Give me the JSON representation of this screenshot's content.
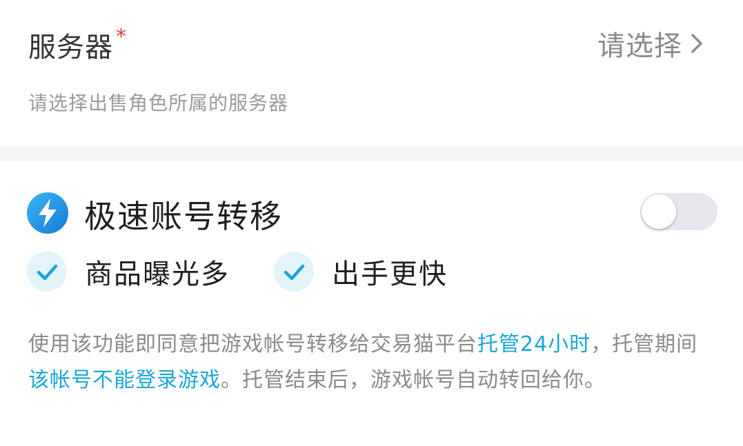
{
  "server": {
    "label": "服务器",
    "required_mark": "*",
    "select_placeholder": "请选择",
    "hint": "请选择出售角色所属的服务器"
  },
  "fast_transfer": {
    "title": "极速账号转移",
    "toggle_on": false,
    "features": [
      {
        "label": "商品曝光多"
      },
      {
        "label": "出手更快"
      }
    ],
    "notice": {
      "part1": "使用该功能即同意把游戏帐号转移给交易猫平台",
      "highlight1": "托管24小时",
      "part2": "，托管期间",
      "highlight2": "该帐号不能登录游戏",
      "part3": "。托管结束后，游戏帐号自动转回给你。"
    }
  },
  "colors": {
    "accent": "#19a6d8",
    "required": "#e03a3a",
    "hint_text": "#9a9a9a",
    "band": "#f4f5f7"
  },
  "icons": {
    "bolt": "lightning-bolt-icon",
    "check": "checkmark-icon",
    "chevron": "chevron-right-icon"
  }
}
